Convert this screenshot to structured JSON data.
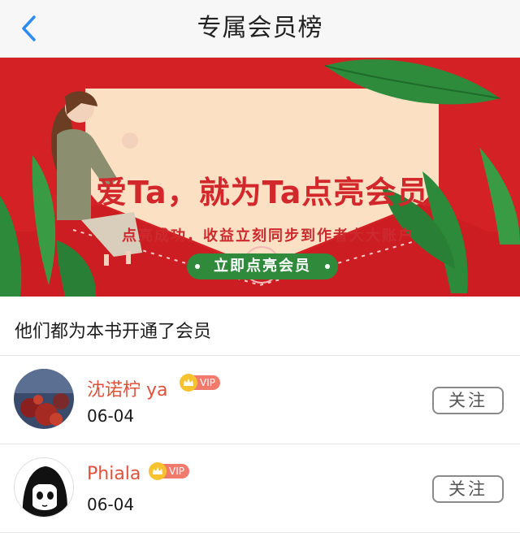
{
  "nav": {
    "title": "专属会员榜",
    "back_icon": "chevron-left-icon"
  },
  "banner": {
    "headline": "爱Ta，就为Ta点亮会员",
    "subtitle": "点亮成功，收益立刻同步到作者大大账户",
    "button_label": "立即点亮会员",
    "colors": {
      "background": "#d42126",
      "panel": "#fbe0c4",
      "button": "#2f8a3c",
      "leaf": "#2c8a3a"
    }
  },
  "section_title": "他们都为本书开通了会员",
  "members": [
    {
      "name": "沈诺柠 ya",
      "vip_label": "VIP",
      "date": "06-04",
      "follow_label": "关注"
    },
    {
      "name": "Phiala",
      "vip_label": "VIP",
      "date": "06-04",
      "follow_label": "关注"
    }
  ],
  "colors": {
    "name": "#e0523c",
    "vip_tag": "#f07a6c",
    "crown": "#f7c230",
    "back_arrow": "#2d8cf0"
  }
}
